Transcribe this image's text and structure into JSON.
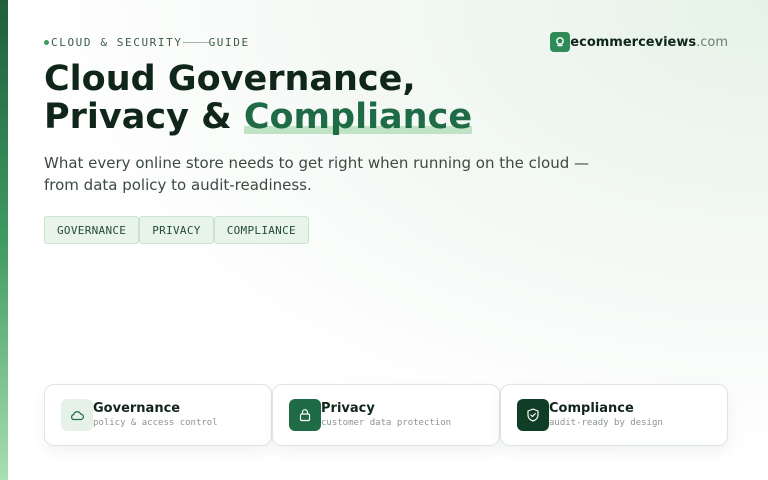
{
  "eyebrow": {
    "left": "CLOUD & SECURITY",
    "right": "GUIDE"
  },
  "brand": {
    "name": "ecommerceviews",
    "tld": ".com"
  },
  "title": {
    "line1": "Cloud Governance,",
    "line2_prefix": "Privacy & ",
    "line2_highlight": "Compliance"
  },
  "subtitle": "What every online store needs to get right when running on the cloud — from data policy to audit-readiness.",
  "tags": [
    "GOVERNANCE",
    "PRIVACY",
    "COMPLIANCE"
  ],
  "cards": [
    {
      "title": "Governance",
      "subtitle": "policy & access control",
      "icon": "cloud-icon"
    },
    {
      "title": "Privacy",
      "subtitle": "customer data protection",
      "icon": "lock-icon"
    },
    {
      "title": "Compliance",
      "subtitle": "audit-ready by design",
      "icon": "shield-check-icon"
    }
  ],
  "colors": {
    "accent": "#1e6b45",
    "accent_light": "#e8f4ea",
    "text": "#10261a"
  }
}
